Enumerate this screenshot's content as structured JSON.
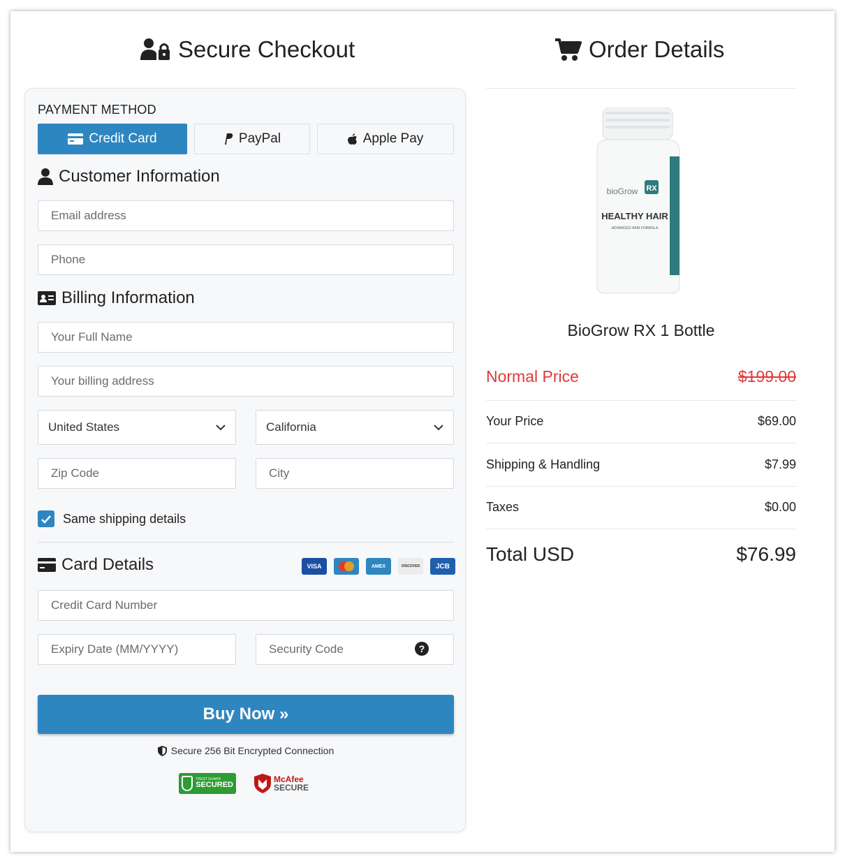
{
  "checkout": {
    "title": "Secure Checkout",
    "payment_method_label": "PAYMENT METHOD",
    "tabs": [
      {
        "label": "Credit Card",
        "active": true
      },
      {
        "label": "PayPal",
        "active": false
      },
      {
        "label": "Apple Pay",
        "active": false
      }
    ],
    "customer_info_title": "Customer Information",
    "email_placeholder": "Email address",
    "phone_placeholder": "Phone",
    "billing_info_title": "Billing Information",
    "full_name_placeholder": "Your Full Name",
    "billing_address_placeholder": "Your billing address",
    "country_selected": "United States",
    "state_selected": "California",
    "zip_placeholder": "Zip Code",
    "city_placeholder": "City",
    "same_shipping_label": "Same shipping details",
    "same_shipping_checked": true,
    "card_details_title": "Card Details",
    "card_logos": [
      "visa",
      "mastercard",
      "amex",
      "discover",
      "jcb"
    ],
    "card_logo_labels": {
      "visa": "VISA",
      "amex": "AMEX",
      "discover": "DISCOVER",
      "jcb": "JCB"
    },
    "card_number_placeholder": "Credit Card Number",
    "expiry_placeholder": "Expiry Date (MM/YYYY)",
    "security_code_placeholder": "Security Code",
    "help_symbol": "?",
    "buy_button_label": "Buy Now »",
    "secure_connection_text": "Secure 256 Bit Encrypted Connection",
    "badge_trust_small": "TRUST GUARD",
    "badge_trust_big": "SECURED",
    "badge_mcafee_1": "McAfee",
    "badge_mcafee_2": "SECURE"
  },
  "order": {
    "title": "Order Details",
    "product_name": "BioGrow RX 1 Bottle",
    "bottle_brand": "bioGrow",
    "bottle_rx": "RX",
    "bottle_label": "HEALTHY HAIR",
    "bottle_sub": "ADVANCED HAIR FORMULA",
    "normal_price_label": "Normal Price",
    "normal_price": "$199.00",
    "your_price_label": "Your Price",
    "your_price": "$69.00",
    "shipping_label": "Shipping & Handling",
    "shipping": "$7.99",
    "taxes_label": "Taxes",
    "taxes": "$0.00",
    "total_label": "Total USD",
    "total": "$76.99"
  },
  "colors": {
    "accent": "#2e86c1",
    "normal_price": "#e03a3a",
    "badge_green": "#2e9b34",
    "mcafee_red": "#c01818"
  }
}
